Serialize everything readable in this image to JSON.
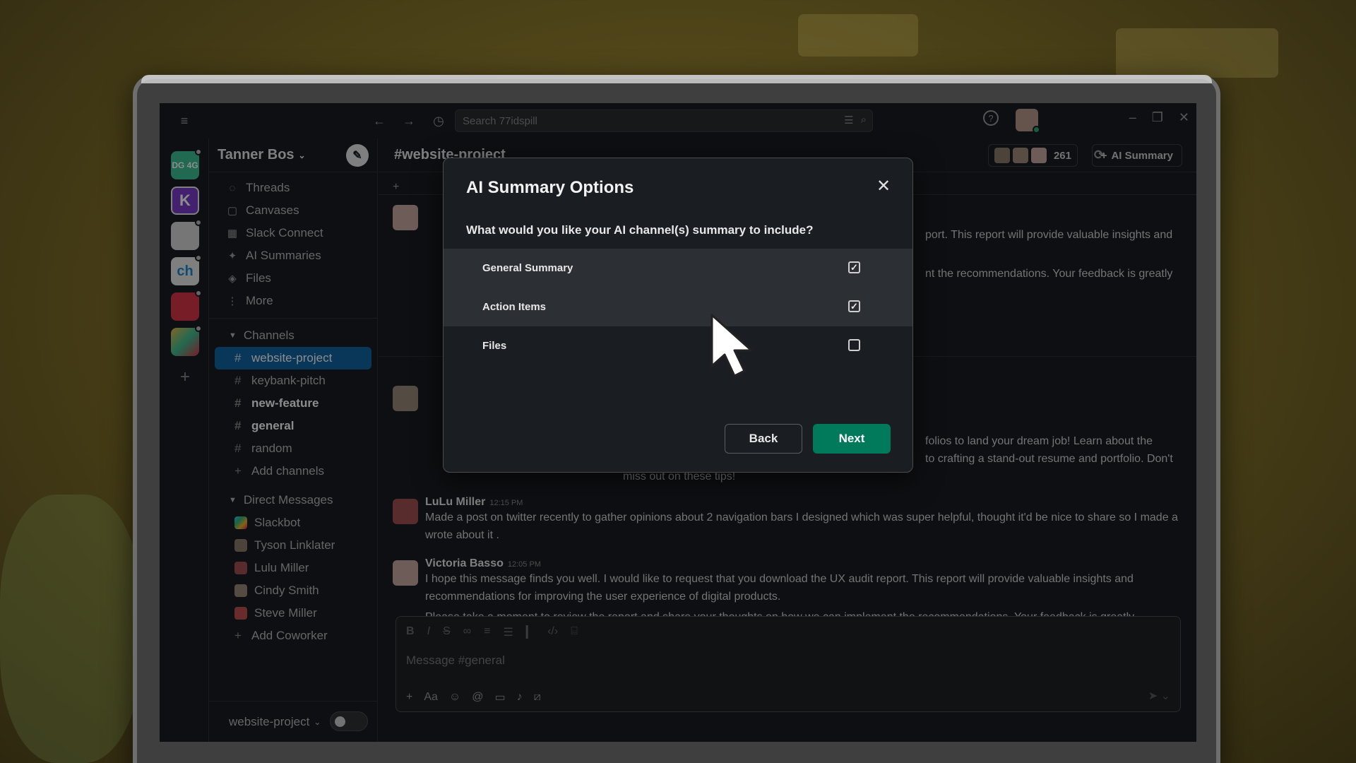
{
  "titlebar": {
    "search_placeholder": "Search 77idspill"
  },
  "workspaces": [
    {
      "label": "DG 4G",
      "color": "#3dbf94"
    },
    {
      "label": "K",
      "color": "#7a3cc9"
    },
    {
      "label": "",
      "color": "#d8d8d8"
    },
    {
      "label": "ch",
      "color": "#e8e8e8"
    },
    {
      "label": "",
      "color": "#d9364a"
    },
    {
      "label": "",
      "color": "#e8e8e8"
    }
  ],
  "sidebar": {
    "workspace_name": "Tanner Bos",
    "nav": [
      {
        "label": "Threads",
        "icon": "threads-icon"
      },
      {
        "label": "Canvases",
        "icon": "canvas-icon"
      },
      {
        "label": "Slack Connect",
        "icon": "building-icon"
      },
      {
        "label": "AI Summaries",
        "icon": "sparkle-icon"
      },
      {
        "label": "Files",
        "icon": "layers-icon"
      },
      {
        "label": "More",
        "icon": "more-icon"
      }
    ],
    "channels_heading": "Channels",
    "channels": [
      {
        "label": "website-project",
        "state": "active"
      },
      {
        "label": "keybank-pitch",
        "state": "normal"
      },
      {
        "label": "new-feature",
        "state": "bold"
      },
      {
        "label": "general",
        "state": "bold"
      },
      {
        "label": "random",
        "state": "normal"
      }
    ],
    "add_channels": "Add channels",
    "dm_heading": "Direct Messages",
    "dms": [
      "Slackbot",
      "Tyson Linklater",
      "Lulu Miller",
      "Cindy Smith",
      "Steve Miller"
    ],
    "add_coworker": "Add Coworker",
    "footer_label": "website-project"
  },
  "main": {
    "channel_title": "#website-project",
    "member_count": "261",
    "ai_summary_button": "AI Summary",
    "fragments": {
      "f1": "port. This report will provide valuable insights and",
      "f2": "nt the recommendations. Your feedback is greatly",
      "f3": "folios to land your dream job! Learn about the",
      "f4": "to crafting a stand-out resume and portfolio. Don't",
      "f5": "miss out on these tips!"
    },
    "messages": [
      {
        "name": "LuLu Miller",
        "time": "12:15 PM",
        "text": "Made a post on twitter recently to gather opinions about 2 navigation bars I designed which was super helpful, thought it'd be nice to share so I made a wrote about it ."
      },
      {
        "name": "Victoria Basso",
        "time": "12:05 PM",
        "text": "I hope this message finds you well. I would like to request that you download the UX audit report. This report will provide valuable insights and recommendations for improving the user experience of digital products.",
        "text2": "Please take a moment to review the report and share your thoughts on how we can implement the recommendations. Your feedback is greatly"
      }
    ],
    "composer_placeholder": "Message #general"
  },
  "modal": {
    "title": "AI Summary Options",
    "question": "What would you like your AI channel(s) summary to include?",
    "options": [
      {
        "label": "General Summary",
        "checked": true
      },
      {
        "label": "Action Items",
        "checked": true
      },
      {
        "label": "Files",
        "checked": false
      }
    ],
    "back_label": "Back",
    "next_label": "Next",
    "check_glyph": "✓"
  }
}
